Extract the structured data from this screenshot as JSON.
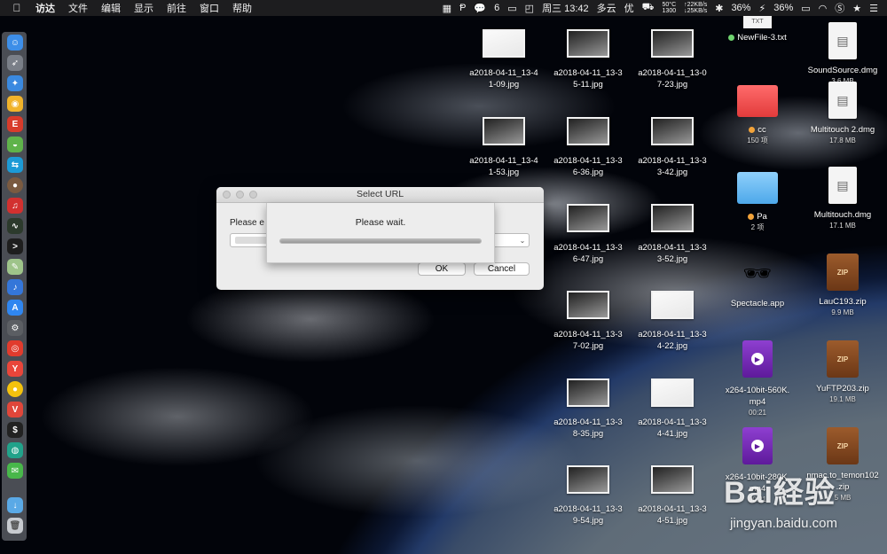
{
  "menubar": {
    "app_name": "访达",
    "items": [
      "文件",
      "编辑",
      "显示",
      "前往",
      "窗口",
      "帮助"
    ],
    "status": {
      "wechat_count": "6",
      "temp": "50°C",
      "fan": "1300",
      "up_speed": "↑22KB/s",
      "down_speed": "↓25KB/s",
      "clock": "周三 13:42",
      "weather": "多云",
      "quality": "优",
      "battery_a": "36%",
      "battery_b": "36%"
    }
  },
  "dialog": {
    "title": "Select URL",
    "prompt": "Please e",
    "ok_label": "OK",
    "cancel_label": "Cancel"
  },
  "wait_sheet": {
    "message": "Please wait.",
    "progress": 1.0
  },
  "files": {
    "col1": [
      {
        "line1": "a2018-04-11_13-4",
        "line2": "1-09.jpg"
      },
      {
        "line1": "a2018-04-11_13-4",
        "line2": "1-53.jpg"
      }
    ],
    "col2": [
      {
        "line1": "a2018-04-11_13-3",
        "line2": "5-11.jpg"
      },
      {
        "line1": "a2018-04-11_13-3",
        "line2": "6-36.jpg"
      },
      {
        "line1": "a2018-04-11_13-3",
        "line2": "6-47.jpg"
      },
      {
        "line1": "a2018-04-11_13-3",
        "line2": "7-02.jpg"
      },
      {
        "line1": "a2018-04-11_13-3",
        "line2": "8-35.jpg"
      },
      {
        "line1": "a2018-04-11_13-3",
        "line2": "9-54.jpg"
      }
    ],
    "col3": [
      {
        "line1": "a2018-04-11_13-0",
        "line2": "7-23.jpg"
      },
      {
        "line1": "a2018-04-11_13-3",
        "line2": "3-42.jpg"
      },
      {
        "line1": "a2018-04-11_13-3",
        "line2": "3-52.jpg"
      },
      {
        "line1": "a2018-04-11_13-3",
        "line2": "4-22.jpg"
      },
      {
        "line1": "a2018-04-11_13-3",
        "line2": "4-41.jpg"
      },
      {
        "line1": "a2018-04-11_13-3",
        "line2": "4-51.jpg"
      }
    ],
    "col4": [
      {
        "line1": "NewFile-3.txt",
        "line2": ""
      },
      {
        "line1": "cc",
        "line2": "150 项"
      },
      {
        "line1": "Pa",
        "line2": "2 项"
      },
      {
        "line1": "Spectacle.app",
        "line2": ""
      },
      {
        "line1": "x264-10bit-560K.",
        "line2": "mp4",
        "line3": "00:21"
      },
      {
        "line1": "x264-10bit-280K.",
        "line2": "mp4",
        "line3": "00:21"
      }
    ],
    "col5": [
      {
        "line1": "SoundSource.dmg",
        "line2": "3.6 MB"
      },
      {
        "line1": "Multitouch 2.dmg",
        "line2": "17.8 MB"
      },
      {
        "line1": "Multitouch.dmg",
        "line2": "17.1 MB"
      },
      {
        "line1": "LauC193.zip",
        "line2": "9.9 MB"
      },
      {
        "line1": "YuFTP203.zip",
        "line2": "19.1 MB"
      },
      {
        "line1": "nmac.to_temon102",
        "line2": ".zip",
        "line3": "5 MB"
      }
    ]
  },
  "icons": {
    "txt_badge": "TXT",
    "zip_badge": "ZIP"
  },
  "colors": {
    "folder_tag_cc": "#f2a33a",
    "folder_tag_pa": "#f2a33a",
    "txt_tag": "#6fd36f"
  },
  "watermark": {
    "brand": "Bai経验",
    "url": "jingyan.baidu.com"
  }
}
